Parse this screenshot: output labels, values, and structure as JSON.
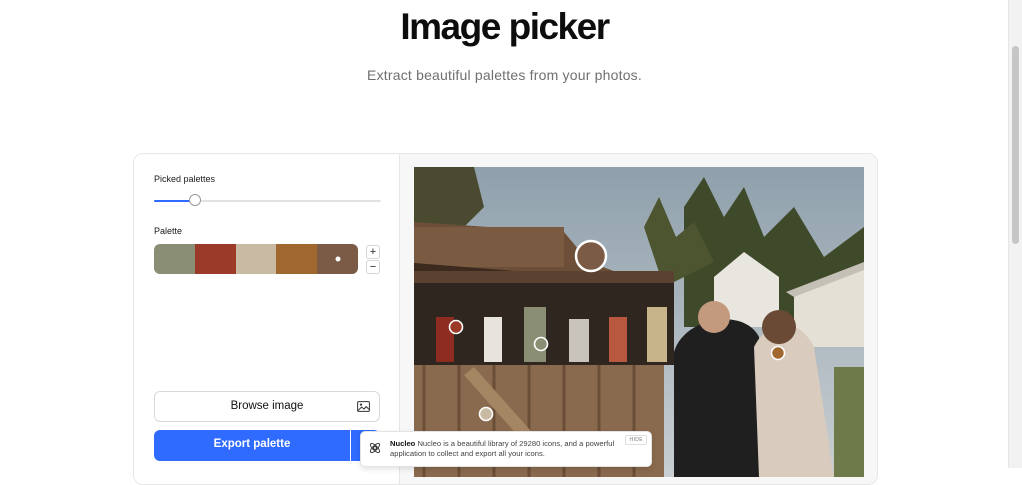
{
  "header": {
    "title": "Image picker",
    "subtitle": "Extract beautiful palettes from your photos."
  },
  "controls": {
    "picked_palettes_label": "Picked palettes",
    "picked_palettes_slider_fraction": 0.1,
    "palette_label": "Palette",
    "palette_colors": [
      "#8a8e75",
      "#9c3a2a",
      "#c9baa3",
      "#a0672f",
      "#7b5b45"
    ],
    "increase_label": "+",
    "decrease_label": "−",
    "browse_label": "Browse image",
    "export_label": "Export palette"
  },
  "colors": {
    "accent": "#2f6bff"
  },
  "toast": {
    "brand": "Nucleo",
    "message": "Nucleo is a beautiful library of 29280 icons, and a powerful application to collect and export all your icons.",
    "hide_label": "HIDE"
  }
}
